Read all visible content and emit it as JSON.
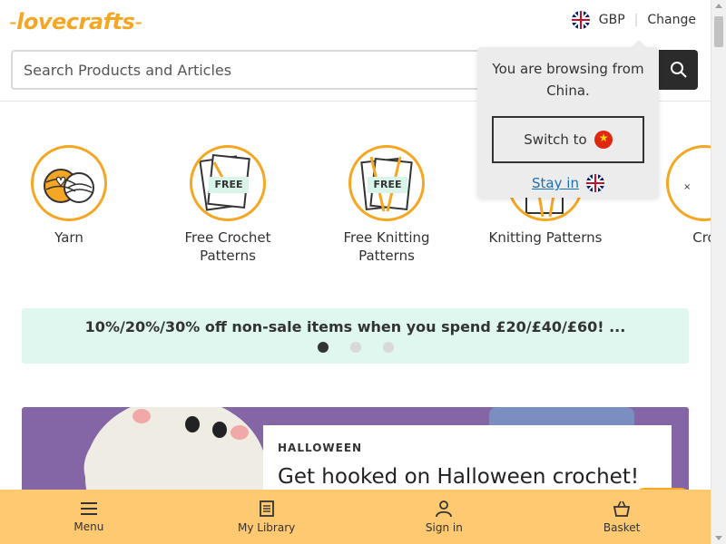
{
  "header": {
    "logo_text": "lovecrafts",
    "currency": "GBP",
    "change_label": "Change",
    "search_placeholder": "Search Products and Articles"
  },
  "popup": {
    "message": "You are browsing from China.",
    "switch_label": "Switch to",
    "stay_label": "Stay in"
  },
  "categories": [
    {
      "label": "Yarn"
    },
    {
      "label": "Free Crochet Patterns",
      "tag": "FREE"
    },
    {
      "label": "Free Knitting Patterns",
      "tag": "FREE"
    },
    {
      "label": "Knitting Patterns"
    },
    {
      "label": "Cro"
    }
  ],
  "promo": {
    "text": "10%/20%/30% off non-sale items when you spend £20/£40/£60! ...",
    "active_slide": 1,
    "slide_count": 3
  },
  "hero": {
    "kicker": "HALLOWEEN",
    "title": "Get hooked on Halloween crochet!"
  },
  "bottom_nav": {
    "menu": "Menu",
    "library": "My Library",
    "sign_in": "Sign in",
    "basket": "Basket"
  },
  "colors": {
    "brand": "#f5a623",
    "nav_bg": "#fec970",
    "promo_bg": "#dff7ef",
    "hero_bg": "#8465a6"
  }
}
